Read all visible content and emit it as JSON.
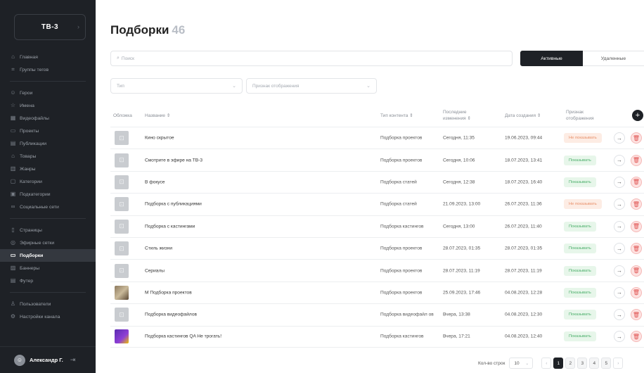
{
  "brand": {
    "name": "ТВ-3",
    "chevron": "chevron-right-icon"
  },
  "nav": [
    {
      "label": "Главная",
      "icon": "home-icon",
      "group": 1
    },
    {
      "label": "Группы тегов",
      "icon": "tag-group-icon",
      "group": 1
    },
    {
      "label": "Герои",
      "icon": "hero-icon",
      "group": 2
    },
    {
      "label": "Имена",
      "icon": "star-icon",
      "group": 2
    },
    {
      "label": "Видеофайлы",
      "icon": "film-icon",
      "group": 2
    },
    {
      "label": "Проекты",
      "icon": "project-icon",
      "group": 2
    },
    {
      "label": "Публикации",
      "icon": "publication-icon",
      "group": 2
    },
    {
      "label": "Товары",
      "icon": "bag-icon",
      "group": 2
    },
    {
      "label": "Жанры",
      "icon": "genre-icon",
      "group": 2
    },
    {
      "label": "Категории",
      "icon": "folder-icon",
      "group": 2
    },
    {
      "label": "Подкатегории",
      "icon": "subfolder-icon",
      "group": 2
    },
    {
      "label": "Социальные сети",
      "icon": "link-icon",
      "group": 2
    },
    {
      "label": "Страницы",
      "icon": "page-icon",
      "group": 3
    },
    {
      "label": "Эфирные сетки",
      "icon": "broadcast-icon",
      "group": 3
    },
    {
      "label": "Подборки",
      "icon": "collection-icon",
      "group": 3,
      "active": true
    },
    {
      "label": "Баннеры",
      "icon": "banner-icon",
      "group": 3
    },
    {
      "label": "Футер",
      "icon": "footer-icon",
      "group": 3
    },
    {
      "label": "Пользователи",
      "icon": "user-icon",
      "group": 4
    },
    {
      "label": "Настройки канала",
      "icon": "gear-icon",
      "group": 4
    }
  ],
  "user": {
    "name": "Александр Г.",
    "avatar_icon": "avatar-icon",
    "logout_icon": "logout-icon"
  },
  "page": {
    "title": "Подборки",
    "count": "46"
  },
  "search": {
    "placeholder": "Поиск",
    "icon": "search-icon"
  },
  "tabs": {
    "active": "Активные",
    "deleted": "Удаленные"
  },
  "filters": {
    "type": "Тип",
    "display": "Признак отображения"
  },
  "columns": {
    "cover": "Обложка",
    "name": "Название ⇕",
    "type": "Тип контента ⇕",
    "modified": [
      "Последние",
      "изменения ⇕"
    ],
    "created": "Дата создания ⇕",
    "display": [
      "Признак",
      "отображения"
    ]
  },
  "rows": [
    {
      "name": "Кино скрытое",
      "type": "Подборка проектов",
      "modified": "Сегодня, 11:35",
      "created": "19.06.2023, 09:44",
      "status": "Не показывать",
      "status_kind": "hide",
      "thumb": "placeholder"
    },
    {
      "name": "Смотрите в эфире на ТВ-3",
      "type": "Подборка проектов",
      "modified": "Сегодня, 10:06",
      "created": "18.07.2023, 13:41",
      "status": "Показывать",
      "status_kind": "show",
      "thumb": "placeholder"
    },
    {
      "name": "В фокусе",
      "type": "Подборка статей",
      "modified": "Сегодня, 12:38",
      "created": "18.07.2023, 16:40",
      "status": "Показывать",
      "status_kind": "show",
      "thumb": "placeholder"
    },
    {
      "name": "Подборка с публикациями",
      "type": "Подборка статей",
      "modified": "21.09.2023, 13:00",
      "created": "26.07.2023, 11:36",
      "status": "Не показывать",
      "status_kind": "hide",
      "thumb": "placeholder"
    },
    {
      "name": "Подборка с кастингами",
      "type": "Подборка кастингов",
      "modified": "Сегодня, 13:00",
      "created": "26.07.2023, 11:40",
      "status": "Показывать",
      "status_kind": "show",
      "thumb": "placeholder"
    },
    {
      "name": "Стиль жизни",
      "type": "Подборка проектов",
      "modified": "28.07.2023, 01:35",
      "created": "28.07.2023, 01:35",
      "status": "Показывать",
      "status_kind": "show",
      "thumb": "placeholder"
    },
    {
      "name": "Сериалы",
      "type": "Подборка проектов",
      "modified": "28.07.2023, 11:19",
      "created": "28.07.2023, 11:19",
      "status": "Показывать",
      "status_kind": "show",
      "thumb": "placeholder"
    },
    {
      "name": "М Подборка проектов",
      "type": "Подборка проектов",
      "modified": "25.09.2023, 17:46",
      "created": "04.08.2023, 12:28",
      "status": "Показывать",
      "status_kind": "show",
      "thumb": "cat"
    },
    {
      "name": "Подборка видеофайлов",
      "type": "Подборка видеофайл ов",
      "modified": "Вчера, 13:38",
      "created": "04.08.2023, 12:30",
      "status": "Показывать",
      "status_kind": "show",
      "thumb": "placeholder"
    },
    {
      "name": "Подборка кастингов QA Не трогать!",
      "type": "Подборка кастингов",
      "modified": "Вчера, 17:21",
      "created": "04.08.2023, 12:40",
      "status": "Показывать",
      "status_kind": "show",
      "thumb": "purple"
    }
  ],
  "pagination": {
    "rows_label": "Кол-во строк",
    "page_size": "10",
    "pages": [
      "1",
      "2",
      "3",
      "4",
      "5"
    ],
    "current": "1"
  },
  "colors": {
    "sidebar": "#1e2126",
    "show": "#4caf6b",
    "hide": "#e8906a",
    "delete": "#e05553"
  }
}
